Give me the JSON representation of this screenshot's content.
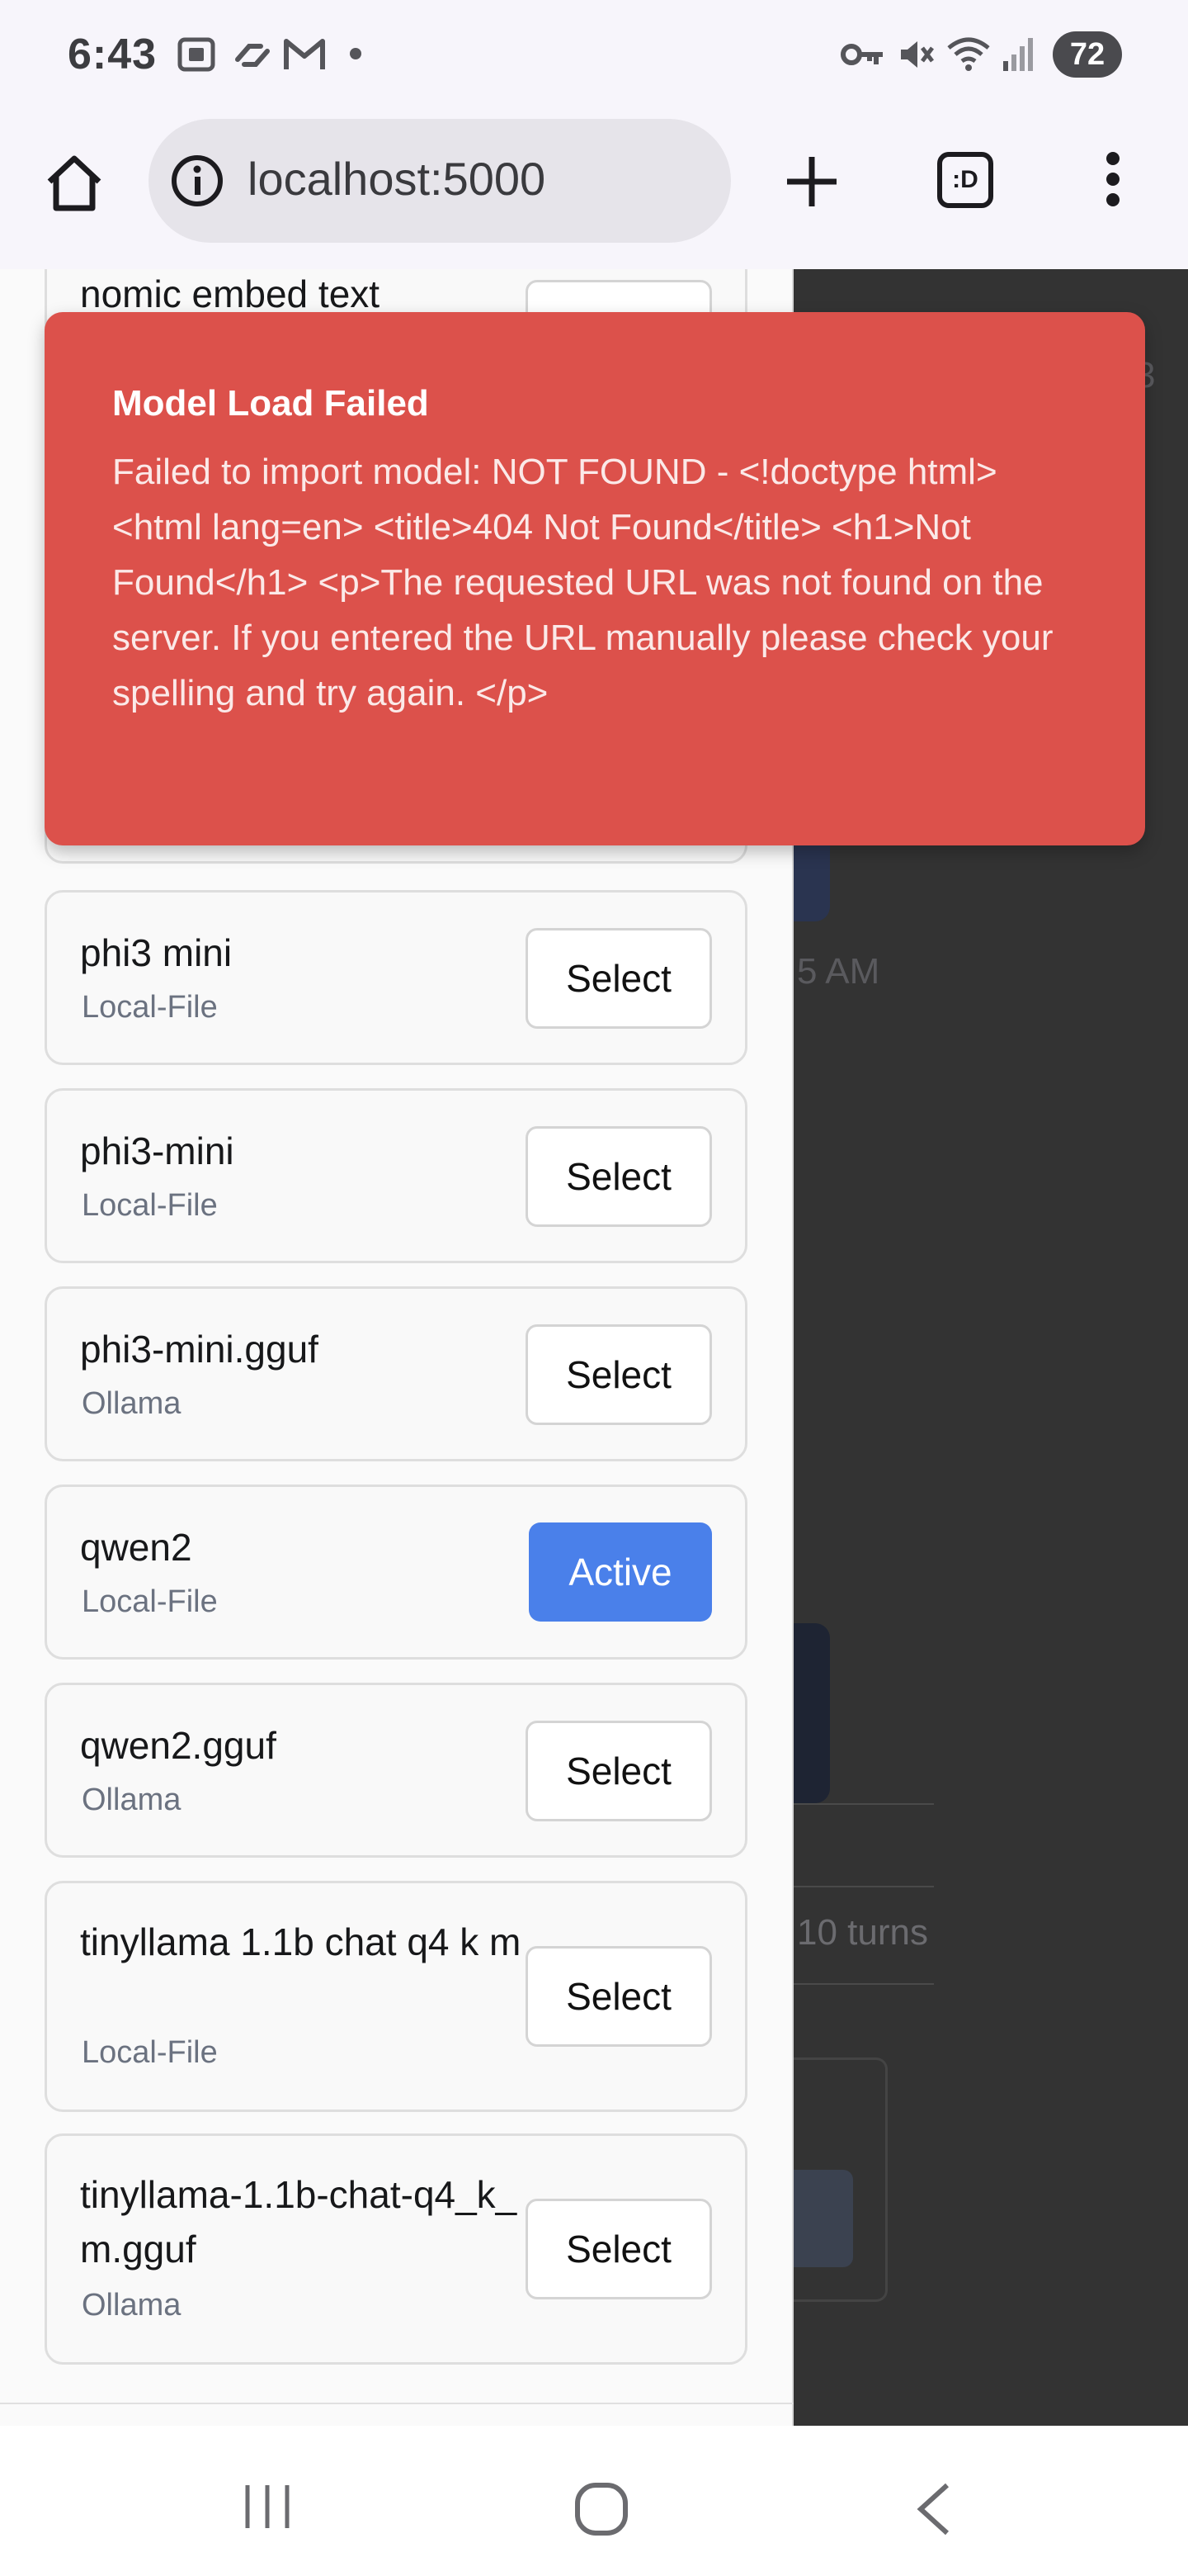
{
  "status_bar": {
    "time": "6:43",
    "battery": "72"
  },
  "browser": {
    "url": "localhost:5000",
    "tabs_label": ":D"
  },
  "models": [
    {
      "name": "nomic embed text",
      "source": "",
      "button": "Select",
      "active": false
    },
    {
      "name": "phi3 mini",
      "source": "Local-File",
      "button": "Select",
      "active": false
    },
    {
      "name": "phi3-mini",
      "source": "Local-File",
      "button": "Select",
      "active": false
    },
    {
      "name": "phi3-mini.gguf",
      "source": "Ollama",
      "button": "Select",
      "active": false
    },
    {
      "name": "qwen2",
      "source": "Local-File",
      "button": "Active",
      "active": true
    },
    {
      "name": "qwen2.gguf",
      "source": "Ollama",
      "button": "Select",
      "active": false
    },
    {
      "name": "tinyllama 1.1b chat q4 k m",
      "source": "Local-File",
      "button": "Select",
      "active": false
    },
    {
      "name": "tinyllama-1.1b-chat-q4_k_m.gguf",
      "source": "Ollama",
      "button": "Select",
      "active": false
    }
  ],
  "toast": {
    "title": "Model Load Failed",
    "message": "Failed to import model: NOT FOUND - <!doctype html> <html lang=en> <title>404 Not Found</title> <h1>Not Found</h1> <p>The requested URL was not found on the server. If you entered the URL manually please check your spelling and try again. </p>"
  },
  "background": {
    "time_fragment": "5 AM",
    "turns_fragment": "10 turns",
    "corner_fragment": "3"
  },
  "colors": {
    "toast_bg": "#dc514b",
    "active_button": "#4a80ea",
    "overlay": "#333333"
  }
}
